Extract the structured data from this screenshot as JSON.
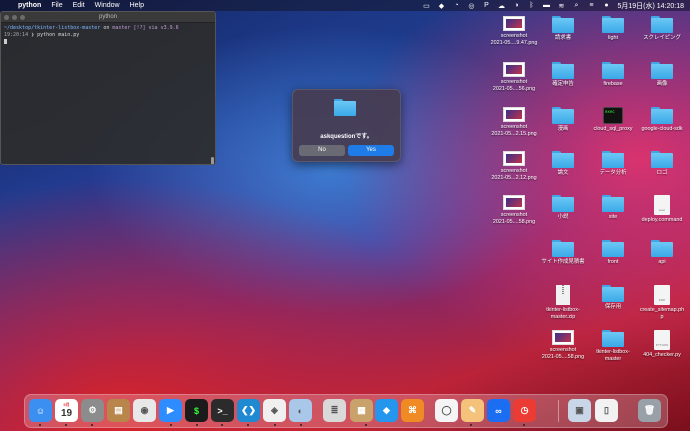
{
  "menubar": {
    "app_name": "python",
    "menus": [
      "File",
      "Edit",
      "Window",
      "Help"
    ],
    "datetime": "5月19日(水)  14:20:18"
  },
  "terminal": {
    "title": "python",
    "line1_path": "~/desktop/tkinter-listbox-master",
    "line1_on": "on",
    "line1_git": "master [!?] via",
    "line1_ver": "v3.9.6",
    "line2_time": "19:20:14",
    "line2_cmd": "❯ python main.py"
  },
  "dialog": {
    "message": "askquestionです。",
    "no_label": "No",
    "yes_label": "Yes"
  },
  "desktop_icons": [
    {
      "label": "screenshot\n2021-05....9.47.png",
      "kind": "screenshot"
    },
    {
      "label": "screenshot\n2021-05....56.png",
      "kind": "screenshot"
    },
    {
      "label": "screenshot\n2021-05...2.15.png",
      "kind": "screenshot"
    },
    {
      "label": "screenshot\n2021-05...2.12.png",
      "kind": "screenshot"
    },
    {
      "label": "screenshot\n2021-05....58.png",
      "kind": "screenshot"
    },
    {
      "label": "請求書",
      "kind": "folder"
    },
    {
      "label": "確定申告",
      "kind": "folder"
    },
    {
      "label": "漫画",
      "kind": "folder"
    },
    {
      "label": "論文",
      "kind": "folder"
    },
    {
      "label": "小説",
      "kind": "folder"
    },
    {
      "label": "サイト作成見積書",
      "kind": "folder"
    },
    {
      "label": "tkinter-listbox-\nmaster.zip",
      "kind": "zip"
    },
    {
      "label": "screenshot\n2021-05....58.png",
      "kind": "screenshot"
    },
    {
      "label": "light",
      "kind": "folder"
    },
    {
      "label": "firebase",
      "kind": "folder"
    },
    {
      "label": "cloud_sql_proxy",
      "kind": "exec"
    },
    {
      "label": "データ分析",
      "kind": "folder"
    },
    {
      "label": "site",
      "kind": "folder"
    },
    {
      "label": "front",
      "kind": "folder"
    },
    {
      "label": "保存用",
      "kind": "folder"
    },
    {
      "label": "tkinter-listbox-\nmaster",
      "kind": "folder"
    },
    {
      "label": "スクレイピング",
      "kind": "folder"
    },
    {
      "label": "画像",
      "kind": "folder"
    },
    {
      "label": "google-cloud-sdk",
      "kind": "folder"
    },
    {
      "label": "ロゴ",
      "kind": "folder"
    },
    {
      "label": "deploy.command",
      "kind": "doc",
      "doc_text": "exec"
    },
    {
      "label": "api",
      "kind": "folder"
    },
    {
      "label": "create_sitemap.ph\np",
      "kind": "doc",
      "doc_text": "PHP"
    },
    {
      "label": "404_checker.py",
      "kind": "doc",
      "doc_text": "PYTHON"
    }
  ],
  "dock": {
    "calendar_day": "19",
    "calendar_month": "5月",
    "items": [
      {
        "name": "finder-icon",
        "color": "#3b8ff0"
      },
      {
        "name": "calendar-icon",
        "color": "#ffffff"
      },
      {
        "name": "system-preferences-icon",
        "color": "#8c8c8c"
      },
      {
        "name": "notes-app-icon",
        "color": "#b8864a"
      },
      {
        "name": "chrome-icon",
        "color": "#e8e8e8"
      },
      {
        "name": "zoom-icon",
        "color": "#2d8cff"
      },
      {
        "name": "terminal-green-icon",
        "color": "#1b1b1b"
      },
      {
        "name": "terminal-icon",
        "color": "#2b2b2b"
      },
      {
        "name": "vscode-icon",
        "color": "#1f8ad2"
      },
      {
        "name": "safari-icon",
        "color": "#f0f0f0"
      },
      {
        "name": "preview-icon",
        "color": "#a9c7e8"
      },
      {
        "name": "database-icon",
        "color": "#d9d9d9"
      },
      {
        "name": "archive-utility-icon",
        "color": "#c9a26b"
      },
      {
        "name": "docker-icon",
        "color": "#2496ed"
      },
      {
        "name": "sourcetree-icon",
        "color": "#f08a24"
      },
      {
        "name": "quicktime-icon",
        "color": "#f5f5f5"
      },
      {
        "name": "preview-app-icon",
        "color": "#f4c27b"
      },
      {
        "name": "infinity-app-icon",
        "color": "#1b6ef2"
      },
      {
        "name": "clock-icon",
        "color": "#ec3b33"
      },
      {
        "name": "photos-folder-icon",
        "color": "#c8d6e8"
      },
      {
        "name": "document-icon",
        "color": "#f2f2f2"
      },
      {
        "name": "trash-icon",
        "color": "#9aa0a8"
      }
    ]
  }
}
